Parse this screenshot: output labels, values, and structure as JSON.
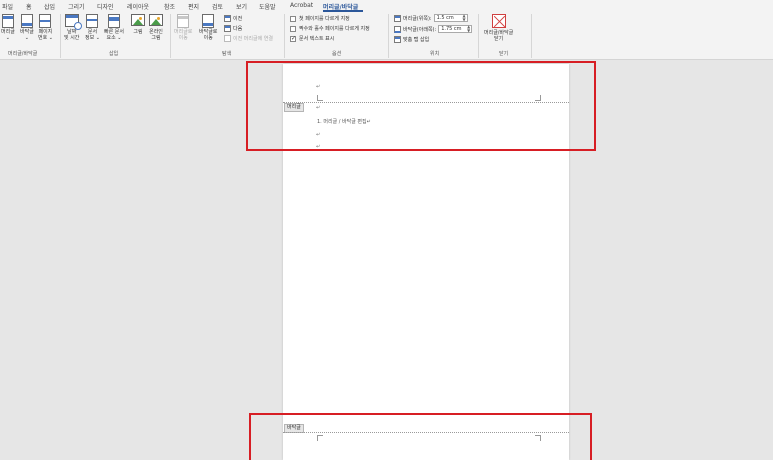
{
  "tabs": [
    "파일",
    "홈",
    "삽입",
    "그리기",
    "디자인",
    "레이아웃",
    "참조",
    "편지",
    "검토",
    "보기",
    "도움말",
    "Acrobat",
    "머리글/바닥글"
  ],
  "active_tab": "머리글/바닥글",
  "ribbon": {
    "group_header_footer": {
      "label": "머리글/바닥글",
      "buttons": [
        {
          "line1": "머리글",
          "line2": "⌄"
        },
        {
          "line1": "바닥글",
          "line2": "⌄"
        },
        {
          "line1": "페이지",
          "line2": "번호 ⌄"
        }
      ]
    },
    "group_insert": {
      "label": "삽입",
      "buttons": [
        {
          "line1": "날짜",
          "line2": "및 시간"
        },
        {
          "line1": "문서",
          "line2": "정보 ⌄"
        },
        {
          "line1": "빠른 문서",
          "line2": "요소 ⌄"
        },
        {
          "line1": "그림",
          "line2": ""
        },
        {
          "line1": "온라인",
          "line2": "그림"
        }
      ]
    },
    "group_nav": {
      "label": "탐색",
      "buttons": [
        {
          "line1": "머리글로",
          "line2": "이동"
        },
        {
          "line1": "바닥글로",
          "line2": "이동"
        }
      ],
      "prev": "이전",
      "next": "다음",
      "link_prev": "이전 머리글에 연결"
    },
    "group_options": {
      "label": "옵션",
      "diff_first": "첫 페이지를 다르게 지정",
      "diff_odd_even": "짝수와 홀수 페이지를 다르게 지정",
      "show_doc_text": "문서 텍스트 표시",
      "show_doc_text_checked": true
    },
    "group_position": {
      "label": "위치",
      "header_top_label": "머리글(위쪽):",
      "header_top_value": "1.5 cm",
      "footer_bottom_label": "바닥글(아래쪽):",
      "footer_bottom_value": "1.75 cm",
      "insert_align_tab": "맞춤 탭 삽입"
    },
    "group_close": {
      "label": "닫기",
      "close_line1": "머리글/바닥글",
      "close_line2": "닫기"
    }
  },
  "document": {
    "header_tag": "머리글",
    "footer_tag": "바닥글",
    "body_line": "1. 머리글 / 바닥글 편집↵",
    "para_mark": "↵"
  },
  "colors": {
    "accent": "#2b579a",
    "highlight_box": "#d71e24"
  }
}
